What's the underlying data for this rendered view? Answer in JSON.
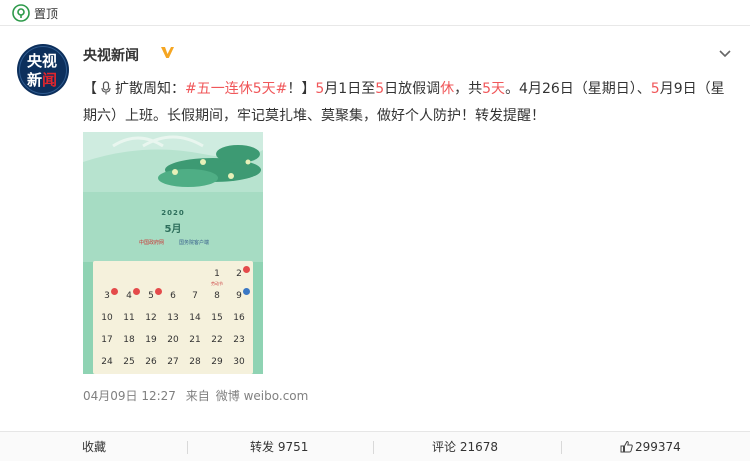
{
  "top": {
    "pin_icon": "pin-icon",
    "pin_label": "置顶"
  },
  "author": {
    "avatar_line1": "央视",
    "avatar_line2_a": "新",
    "avatar_line2_b": "闻",
    "name": "央视新闻",
    "verified_icon": "verified-v-icon"
  },
  "post": {
    "p01": "【",
    "p02": "扩散周知：",
    "p03": "#五一连休5天#",
    "p04": "！】",
    "p05": "5",
    "p06": "月1日至",
    "p07": "5",
    "p08": "日放假调",
    "p09": "休",
    "p10": "，共",
    "p11": "5天",
    "p12": "。4月26日（星期日）、",
    "p13": "5",
    "p14": "月9日（星期六）上班。长假期间，牢记莫扎堆、莫聚集，做好个人防护！转发提醒！"
  },
  "poster": {
    "year": "2020",
    "month": "5月",
    "org1": "中国政府网",
    "org2": "国务院客户端",
    "calendar": [
      {
        "d": "1",
        "sub": "劳动节",
        "badge": ""
      },
      {
        "d": "2",
        "sub": "",
        "badge": "red"
      },
      {
        "d": "3",
        "sub": "",
        "badge": "red"
      },
      {
        "d": "4",
        "sub": "",
        "badge": "red"
      },
      {
        "d": "5",
        "sub": "",
        "badge": "red"
      },
      {
        "d": "6",
        "sub": "",
        "badge": ""
      },
      {
        "d": "7",
        "sub": "",
        "badge": ""
      },
      {
        "d": "8",
        "sub": "",
        "badge": ""
      },
      {
        "d": "9",
        "sub": "",
        "badge": "blue"
      },
      {
        "d": "10",
        "sub": "",
        "badge": ""
      },
      {
        "d": "11",
        "sub": "",
        "badge": ""
      },
      {
        "d": "12",
        "sub": "",
        "badge": ""
      },
      {
        "d": "13",
        "sub": "",
        "badge": ""
      },
      {
        "d": "14",
        "sub": "",
        "badge": ""
      },
      {
        "d": "15",
        "sub": "",
        "badge": ""
      },
      {
        "d": "16",
        "sub": "",
        "badge": ""
      },
      {
        "d": "17",
        "sub": "",
        "badge": ""
      },
      {
        "d": "18",
        "sub": "",
        "badge": ""
      },
      {
        "d": "19",
        "sub": "",
        "badge": ""
      },
      {
        "d": "20",
        "sub": "",
        "badge": ""
      },
      {
        "d": "21",
        "sub": "",
        "badge": ""
      },
      {
        "d": "22",
        "sub": "",
        "badge": ""
      },
      {
        "d": "23",
        "sub": "",
        "badge": ""
      },
      {
        "d": "24",
        "sub": "",
        "badge": ""
      },
      {
        "d": "25",
        "sub": "",
        "badge": ""
      },
      {
        "d": "26",
        "sub": "",
        "badge": ""
      },
      {
        "d": "27",
        "sub": "",
        "badge": ""
      },
      {
        "d": "28",
        "sub": "",
        "badge": ""
      },
      {
        "d": "29",
        "sub": "",
        "badge": ""
      },
      {
        "d": "30",
        "sub": "",
        "badge": ""
      }
    ]
  },
  "meta": {
    "date": "04月09日 12:27",
    "from": "来自",
    "source": "微博 weibo.com"
  },
  "actions": {
    "collect": "收藏",
    "repost": "转发 9751",
    "comment": "评论 21678",
    "like_count": "299374",
    "like_icon": "thumbs-up-icon"
  },
  "colors": {
    "highlight": "#f0575a",
    "meta_gray": "#808080",
    "avatar_bg": "#0c2f5c",
    "verified": "#f5a623"
  }
}
